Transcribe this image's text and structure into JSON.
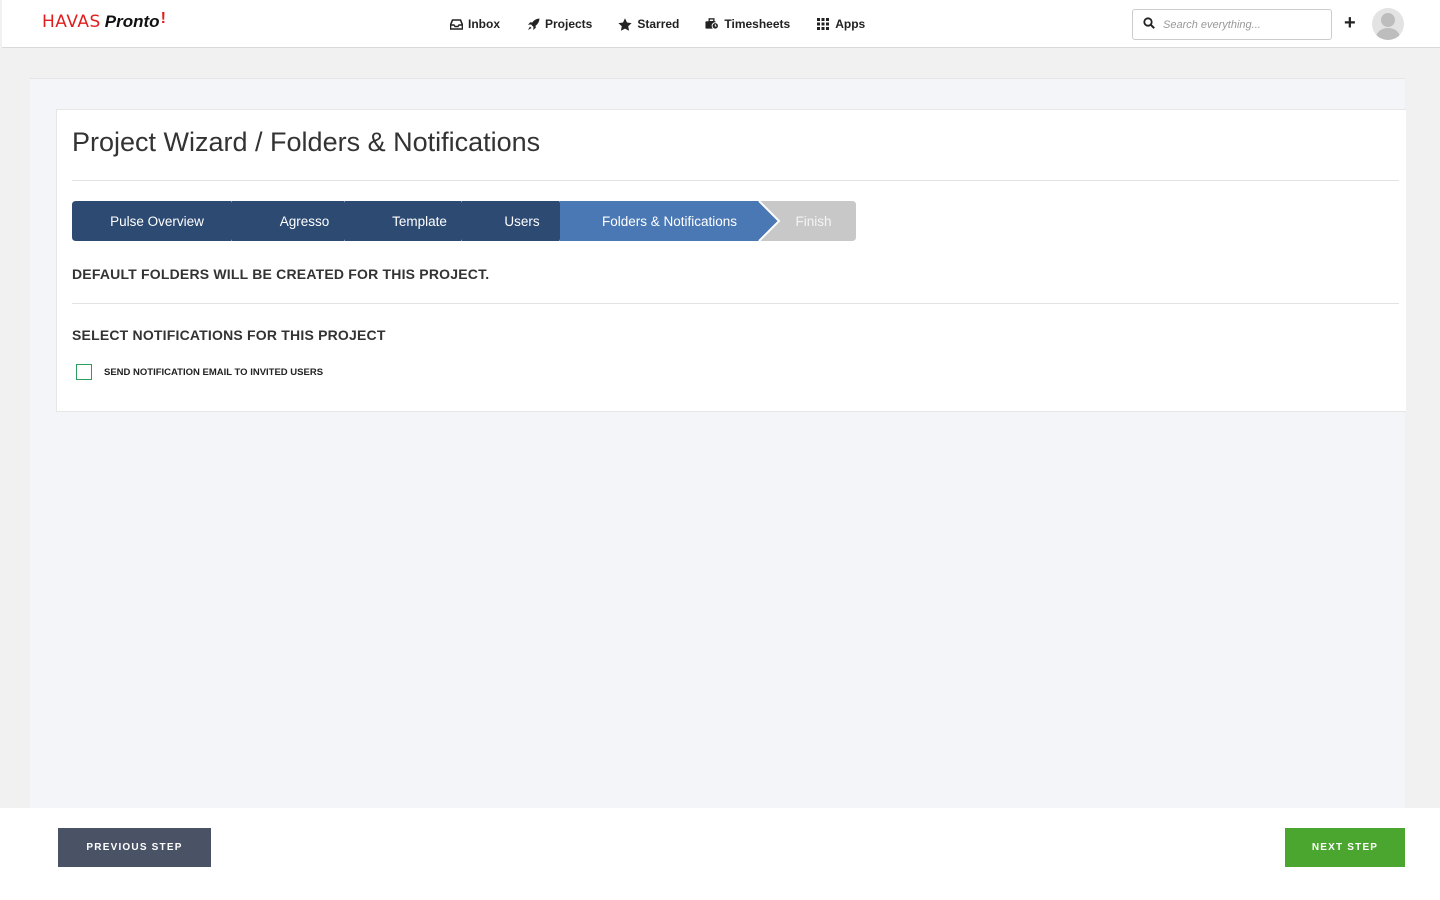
{
  "brand": {
    "havas": "HAVAS",
    "pronto": "Pronto",
    "bolt": "!"
  },
  "nav": {
    "items": [
      {
        "label": "Inbox",
        "icon": "inbox-icon"
      },
      {
        "label": "Projects",
        "icon": "rocket-icon"
      },
      {
        "label": "Starred",
        "icon": "star-icon"
      },
      {
        "label": "Timesheets",
        "icon": "timesheet-icon"
      },
      {
        "label": "Apps",
        "icon": "grid-icon"
      }
    ]
  },
  "search": {
    "placeholder": "Search everything...",
    "value": ""
  },
  "header_actions": {
    "add": "+"
  },
  "page": {
    "title": "Project Wizard / Folders & Notifications",
    "steps": [
      {
        "label": "Pulse Overview",
        "state": "done"
      },
      {
        "label": "Agresso",
        "state": "done"
      },
      {
        "label": "Template",
        "state": "done"
      },
      {
        "label": "Users",
        "state": "done"
      },
      {
        "label": "Folders & Notifications",
        "state": "active"
      },
      {
        "label": "Finish",
        "state": "pending"
      }
    ],
    "folders_note": "DEFAULT FOLDERS WILL BE CREATED FOR THIS PROJECT.",
    "notifications_heading": "SELECT NOTIFICATIONS FOR THIS PROJECT",
    "notification_option": {
      "label": "SEND NOTIFICATION EMAIL TO INVITED USERS",
      "checked": false
    }
  },
  "footer": {
    "previous_label": "PREVIOUS STEP",
    "next_label": "NEXT STEP"
  },
  "colors": {
    "step_done": "#2d4a73",
    "step_active": "#4a78b5",
    "step_pending": "#c8c8c8",
    "next_button": "#4aa62e",
    "prev_button": "#4a5366",
    "brand_red": "#e01e1e"
  }
}
